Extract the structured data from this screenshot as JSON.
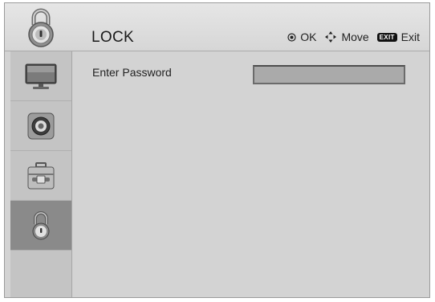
{
  "header": {
    "title": "LOCK",
    "icon": "lock-icon",
    "hints": [
      {
        "icon": "ok-dot-icon",
        "label": "OK"
      },
      {
        "icon": "move-arrows-icon",
        "label": "Move"
      },
      {
        "icon": "exit-key-icon",
        "badge": "EXIT",
        "label": "Exit"
      }
    ]
  },
  "sidebar": {
    "items": [
      {
        "name": "picture",
        "icon": "monitor-icon",
        "active": false
      },
      {
        "name": "audio",
        "icon": "speaker-icon",
        "active": false
      },
      {
        "name": "option",
        "icon": "toolbox-icon",
        "active": false
      },
      {
        "name": "lock",
        "icon": "lock-icon",
        "active": true
      },
      {
        "name": "empty",
        "icon": "",
        "active": false
      }
    ]
  },
  "main": {
    "password": {
      "label": "Enter Password",
      "value": ""
    }
  },
  "colors": {
    "background": "#d3d3d3",
    "sidebar": "#c4c4c4",
    "active_item": "#8a8a8a",
    "input": "#aaaaaa"
  }
}
